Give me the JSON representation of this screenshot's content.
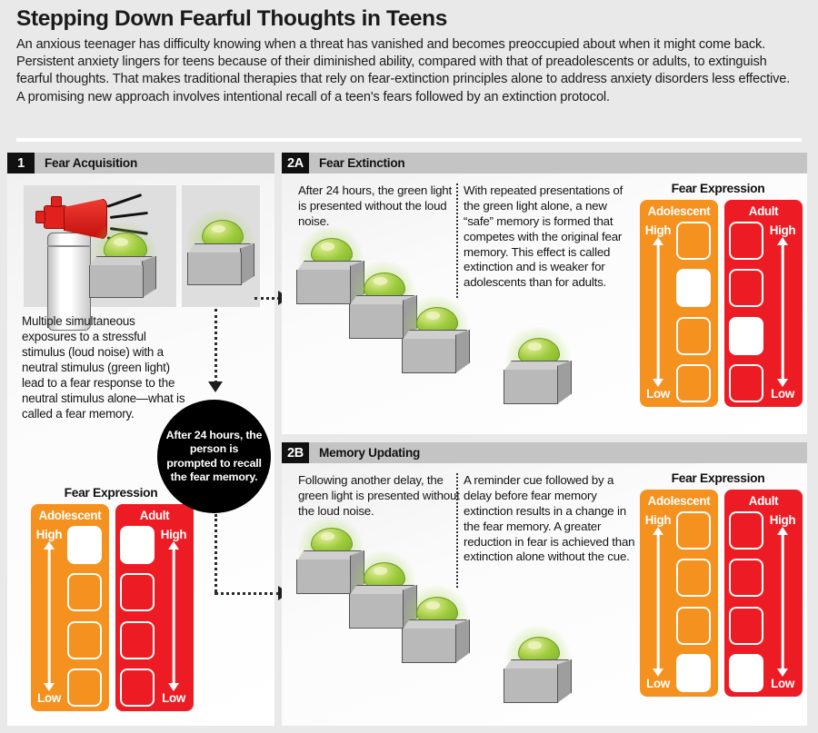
{
  "header": {
    "title": "Stepping Down Fearful Thoughts in Teens",
    "intro": "An anxious teenager has difficulty knowing when a threat has vanished and becomes preoccupied about when it might come back. Persistent anxiety lingers for teens because of their diminished ability, compared with that of preadolescents or adults, to extinguish fearful thoughts. That makes traditional therapies that rely on fear-extinction principles alone to address anxiety disorders less effective. A promising new approach involves intentional recall of a teen's fears followed by an extinction protocol."
  },
  "panels": {
    "p1": {
      "number": "1",
      "name": "Fear Acquisition",
      "caption": "Multiple simultaneous exposures to a stressful stimulus (loud noise) with a neutral stimulus (green light) lead to a fear response to the neutral stimulus alone—what is called a fear memory."
    },
    "p2a": {
      "number": "2A",
      "name": "Fear Extinction",
      "left_text": "After 24 hours, the green light is presented without the loud noise.",
      "right_text": "With repeated presentations of the green light alone, a new “safe” memory is formed that competes with the original fear memory. This effect is called extinction and is weaker for adolescents than for adults."
    },
    "p2b": {
      "number": "2B",
      "name": "Memory Updating",
      "left_text": "Following another delay, the green light is presented without the loud noise.",
      "right_text": "A reminder cue followed by a delay before fear memory extinction results in a change in the fear memory. A greater reduction in fear is achieved than extinction alone without the cue."
    }
  },
  "circle_note": "After 24 hours, the person is prompted to recall the fear memory.",
  "colors": {
    "adolescent": "#F5911E",
    "adult": "#ED1C24",
    "panel_header": "#C4C4C4",
    "badge": "#111111",
    "background": "#E9E9E9"
  },
  "chart_data": [
    {
      "id": "fe_panel1",
      "type": "bar",
      "title": "Fear Expression",
      "categories": [
        "Adolescent",
        "Adult"
      ],
      "scale_labels": {
        "high": "High",
        "low": "Low"
      },
      "levels": 4,
      "ylabel": "Fear Expression",
      "values": [
        4,
        4
      ],
      "series": [
        {
          "name": "Adolescent",
          "filled_level_from_top": 1,
          "value": 4,
          "color": "#F5911E"
        },
        {
          "name": "Adult",
          "filled_level_from_top": 1,
          "value": 4,
          "color": "#ED1C24"
        }
      ]
    },
    {
      "id": "fe_panel2a",
      "type": "bar",
      "title": "Fear Expression",
      "categories": [
        "Adolescent",
        "Adult"
      ],
      "scale_labels": {
        "high": "High",
        "low": "Low"
      },
      "levels": 4,
      "ylabel": "Fear Expression",
      "values": [
        3,
        2
      ],
      "series": [
        {
          "name": "Adolescent",
          "filled_level_from_top": 2,
          "value": 3,
          "color": "#F5911E"
        },
        {
          "name": "Adult",
          "filled_level_from_top": 3,
          "value": 2,
          "color": "#ED1C24"
        }
      ]
    },
    {
      "id": "fe_panel2b",
      "type": "bar",
      "title": "Fear Expression",
      "categories": [
        "Adolescent",
        "Adult"
      ],
      "scale_labels": {
        "high": "High",
        "low": "Low"
      },
      "levels": 4,
      "ylabel": "Fear Expression",
      "values": [
        1,
        1
      ],
      "series": [
        {
          "name": "Adolescent",
          "filled_level_from_top": 4,
          "value": 1,
          "color": "#F5911E"
        },
        {
          "name": "Adult",
          "filled_level_from_top": 4,
          "value": 1,
          "color": "#ED1C24"
        }
      ]
    }
  ]
}
